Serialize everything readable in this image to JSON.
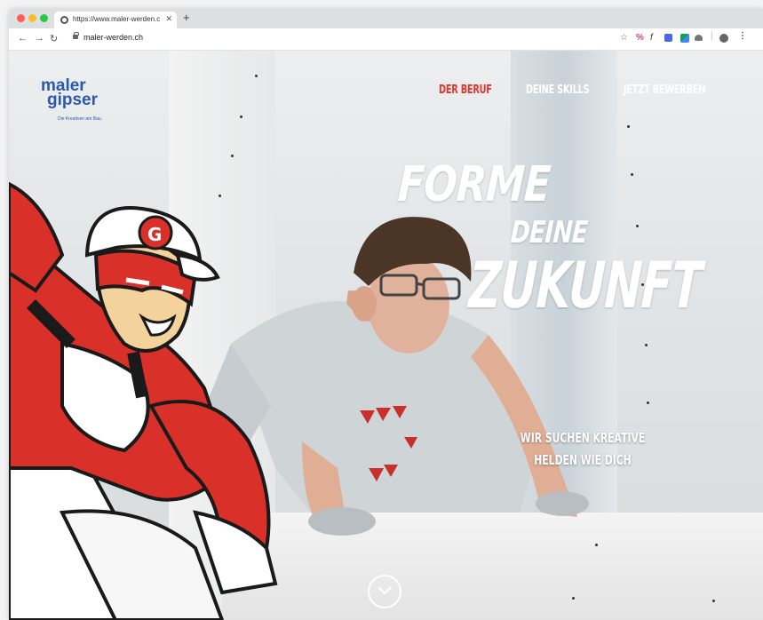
{
  "browser": {
    "tab": {
      "title": "https://www.maler-werden.ch"
    },
    "url": "maler-werden.ch"
  },
  "site": {
    "logo": {
      "line1": "maler",
      "line2": "gipser",
      "tagline": "Die Kreativen am Bau."
    },
    "nav": [
      {
        "label": "DER BERUF",
        "active": true
      },
      {
        "label": "DEINE SKILLS",
        "active": false
      },
      {
        "label": "JETZT BEWERBEN",
        "active": false
      }
    ],
    "hero": {
      "line1": "FORME",
      "line2": "DEINE",
      "line3": "ZUKUNFT",
      "sub1": "WIR SUCHEN KREATIVE",
      "sub2": "HELDEN WIE DICH"
    }
  },
  "colors": {
    "accent": "#e2332c",
    "nav_inactive": "#ffffff",
    "logo_blue": "#2b5aa8"
  }
}
